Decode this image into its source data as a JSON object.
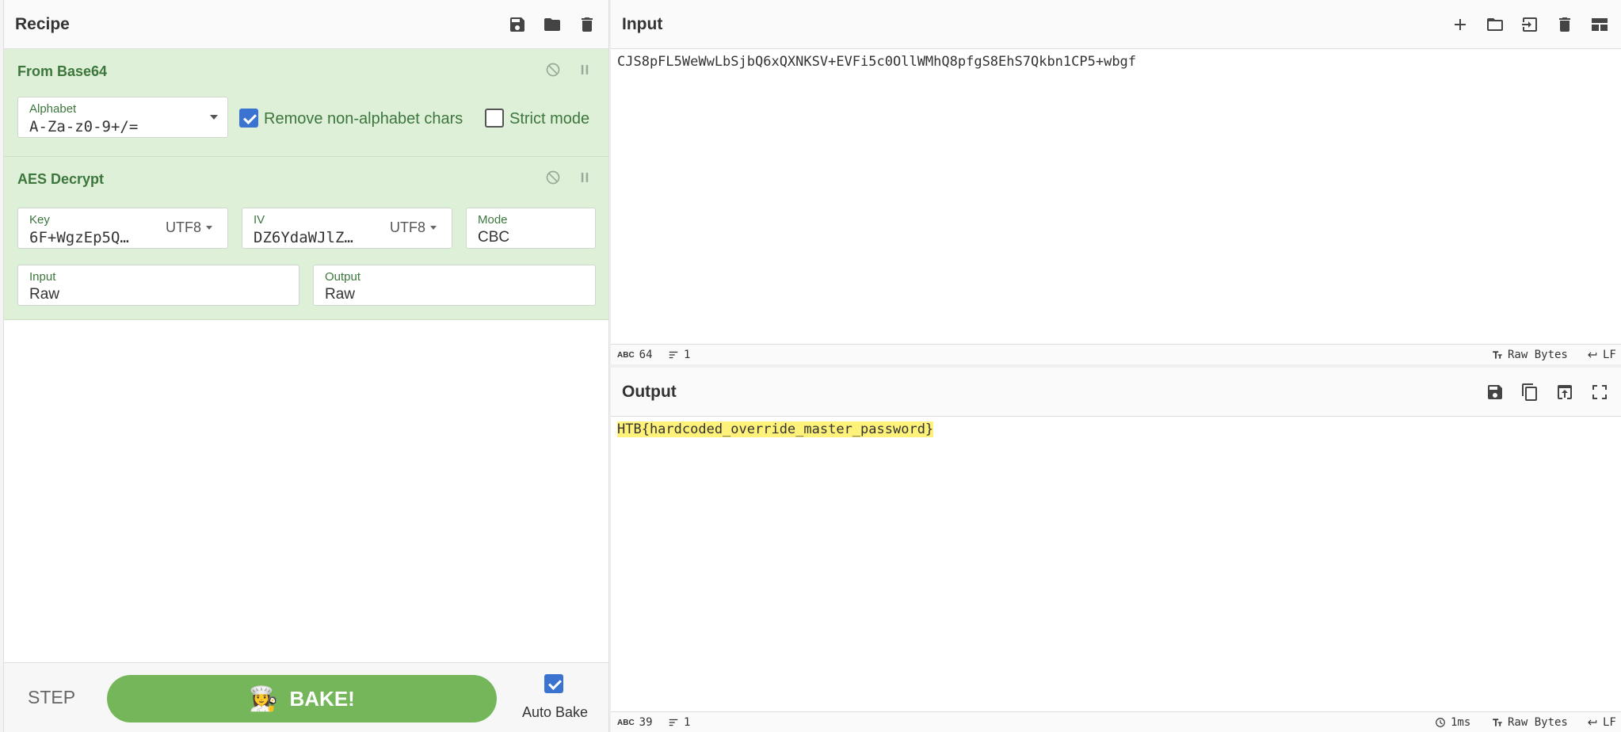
{
  "recipe": {
    "title": "Recipe",
    "operations": [
      {
        "title": "From Base64",
        "alphabet_label": "Alphabet",
        "alphabet_value": "A-Za-z0-9+/=",
        "remove_label": "Remove non-alphabet chars",
        "remove_checked": true,
        "strict_label": "Strict mode",
        "strict_checked": false
      },
      {
        "title": "AES Decrypt",
        "key_label": "Key",
        "key_value": "6F+WgzEp5Q…",
        "key_encoding": "UTF8",
        "iv_label": "IV",
        "iv_value": "DZ6YdaWJlZ…",
        "iv_encoding": "UTF8",
        "mode_label": "Mode",
        "mode_value": "CBC",
        "input_label": "Input",
        "input_value": "Raw",
        "output_label": "Output",
        "output_value": "Raw"
      }
    ],
    "controls": {
      "step_label": "STEP",
      "bake_label": "BAKE!",
      "autobake_label": "Auto Bake",
      "autobake_checked": true
    }
  },
  "input": {
    "title": "Input",
    "text": "CJS8pFL5WeWwLbSjbQ6xQXNKSV+EVFi5c0OllWMhQ8pfgS8EhS7Qkbn1CP5+wbgf",
    "status": {
      "length": "64",
      "lines": "1",
      "format": "Raw Bytes",
      "eol": "LF"
    }
  },
  "output": {
    "title": "Output",
    "text": "HTB{hardcoded_override_master_password}",
    "status": {
      "length": "39",
      "lines": "1",
      "time": "1ms",
      "format": "Raw Bytes",
      "eol": "LF"
    }
  },
  "colors": {
    "op_bg": "#dff0d8",
    "op_text": "#3c763d",
    "bake": "#75b65a",
    "highlight": "#fff27a",
    "checkbox": "#3b73d1"
  }
}
